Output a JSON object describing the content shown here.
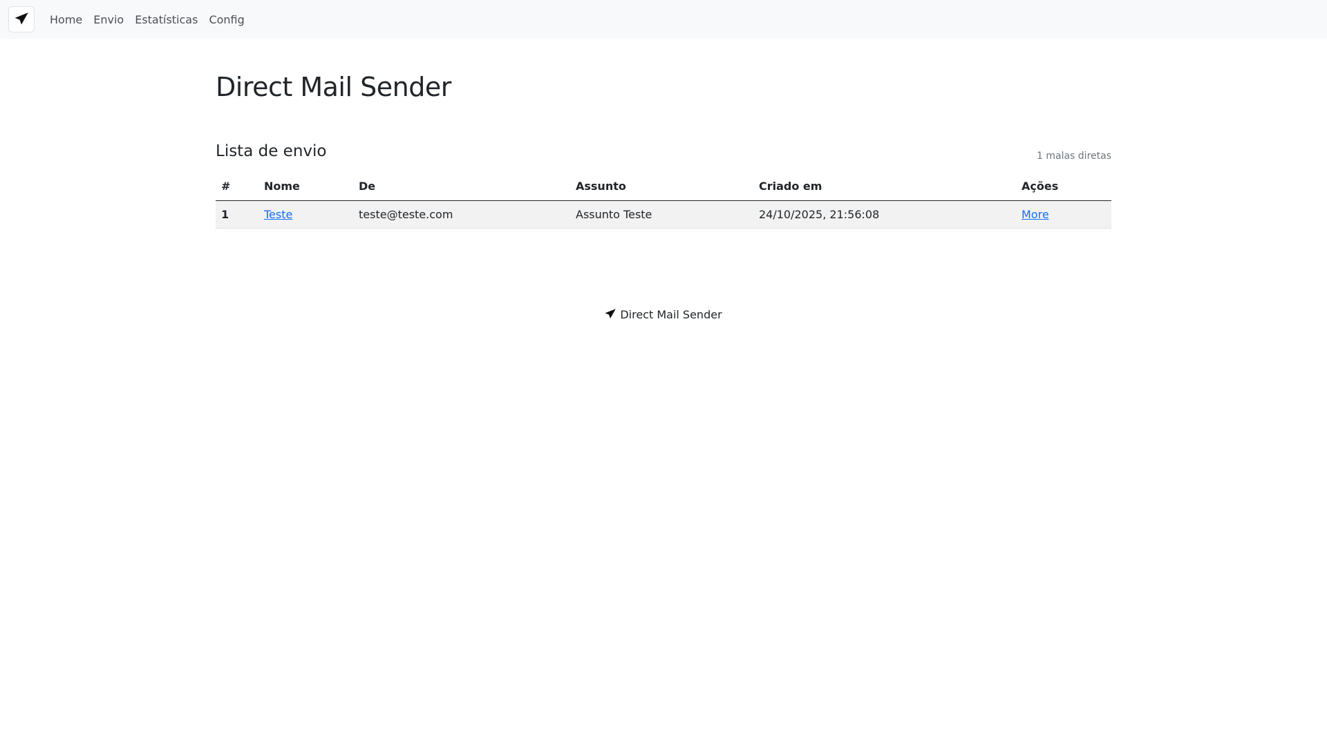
{
  "nav": {
    "brand_icon": "send-icon",
    "links": [
      "Home",
      "Envio",
      "Estatísticas",
      "Config"
    ]
  },
  "page": {
    "title": "Direct Mail Sender"
  },
  "list": {
    "title": "Lista de envio",
    "count": "1 malas diretas",
    "columns": [
      "#",
      "Nome",
      "De",
      "Assunto",
      "Criado em",
      "Ações"
    ],
    "rows": [
      {
        "index": "1",
        "name": "Teste",
        "from": "teste@teste.com",
        "subject": "Assunto Teste",
        "created": "24/10/2025, 21:56:08",
        "action": "More"
      }
    ]
  },
  "footer": {
    "icon": "send-icon",
    "text": "Direct Mail Sender"
  },
  "colors": {
    "navbar_bg": "#f8f9fa",
    "link": "#0d6efd",
    "row_bg": "#f2f2f2"
  }
}
